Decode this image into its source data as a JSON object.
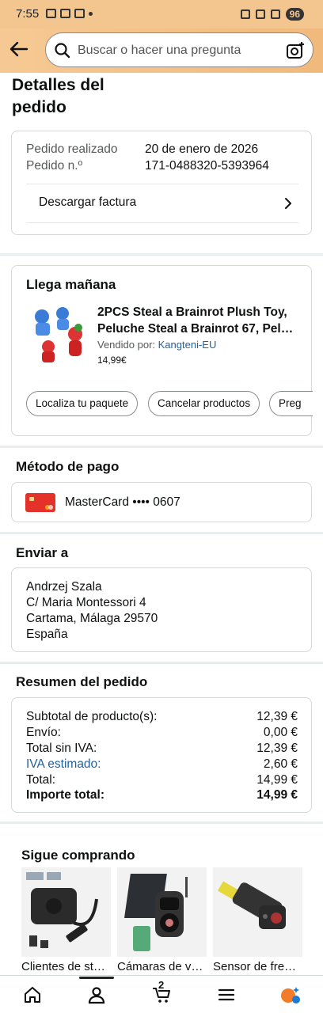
{
  "status_bar": {
    "time": "7:55",
    "battery": "96"
  },
  "header": {
    "search_placeholder": "Buscar o hacer una pregunta"
  },
  "page_title": "Detalles del pedido",
  "order_info": {
    "placed_label": "Pedido realizado",
    "placed_value": "20 de enero de 2026",
    "number_label": "Pedido n.º",
    "number_value": "171-0488320-5393964",
    "invoice_label": "Descargar factura"
  },
  "delivery": {
    "title": "Llega mañana",
    "product_title": "2PCS Steal a Brainrot Plush Toy, Peluche Steal a Brainrot 67, Pel…",
    "sold_by_label": "Vendido por:",
    "seller": "Kangteni-EU",
    "price": "14,99€",
    "actions": [
      "Localiza tu paquete",
      "Cancelar productos",
      "Preg"
    ]
  },
  "payment": {
    "title": "Método de pago",
    "card": "MasterCard •••• 0607"
  },
  "shipping": {
    "title": "Enviar a",
    "lines": [
      "Andrzej Szala",
      "C/ Maria Montessori 4",
      "Cartama, Málaga 29570",
      "España"
    ]
  },
  "summary": {
    "title": "Resumen del pedido",
    "rows": [
      {
        "label": "Subtotal de producto(s):",
        "value": "12,39 €"
      },
      {
        "label": "Envío:",
        "value": "0,00 €"
      },
      {
        "label": "Total sin IVA:",
        "value": "12,39 €"
      },
      {
        "label": "IVA estimado:",
        "value": "2,60 €"
      },
      {
        "label": "Total:",
        "value": "14,99 €"
      },
      {
        "label": "Importe total:",
        "value": "14,99 €"
      }
    ]
  },
  "keep_shopping": {
    "title": "Sigue comprando",
    "items": [
      "Clientes de st…",
      "Cámaras de v…",
      "Sensor de fre…"
    ]
  },
  "bottom_nav": {
    "cart_count": "2"
  },
  "colors": {
    "header_bg": "#f3c690",
    "link": "#2162a1",
    "card_red": "#e4322b"
  }
}
